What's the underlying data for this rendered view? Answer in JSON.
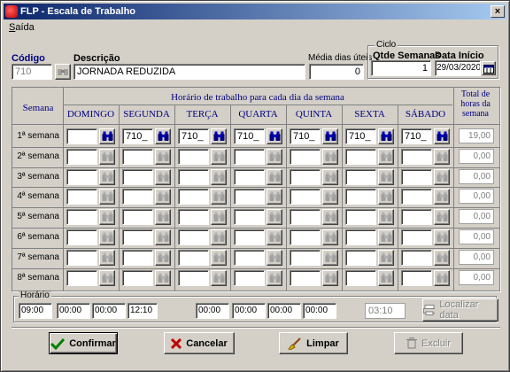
{
  "window": {
    "title": "FLP - Escala de Trabalho",
    "close_label": "×"
  },
  "menu": {
    "items": [
      {
        "label": "Saída"
      }
    ]
  },
  "form": {
    "codigo_label": "Código",
    "codigo_value": "710",
    "descricao_label": "Descrição",
    "descricao_value": "JORNADA REDUZIDA",
    "media_label": "Média dias úteis",
    "media_value": "0",
    "ciclo_title": "Ciclo",
    "qtde_semanas_label": "Qtde Semanas",
    "qtde_semanas_value": "1",
    "data_inicio_label": "Data Início",
    "data_inicio_value": "29/03/2020"
  },
  "grid": {
    "semana_header": "Semana",
    "horario_header": "Horário de trabalho para cada dia da semana",
    "total_header": "Total de horas da semana",
    "days": [
      "DOMINGO",
      "SEGUNDA",
      "TERÇA",
      "QUARTA",
      "QUINTA",
      "SEXTA",
      "SÁBADO"
    ],
    "weeks": [
      {
        "label": "1ª semana",
        "cells": [
          "",
          "710_",
          "710_",
          "710_",
          "710_",
          "710_",
          "710_"
        ],
        "total": "19,00"
      },
      {
        "label": "2ª semana",
        "cells": [
          "",
          "",
          "",
          "",
          "",
          "",
          ""
        ],
        "total": "0,00"
      },
      {
        "label": "3ª semana",
        "cells": [
          "",
          "",
          "",
          "",
          "",
          "",
          ""
        ],
        "total": "0,00"
      },
      {
        "label": "4ª semana",
        "cells": [
          "",
          "",
          "",
          "",
          "",
          "",
          ""
        ],
        "total": "0,00"
      },
      {
        "label": "5ª semana",
        "cells": [
          "",
          "",
          "",
          "",
          "",
          "",
          ""
        ],
        "total": "0,00"
      },
      {
        "label": "6ª semana",
        "cells": [
          "",
          "",
          "",
          "",
          "",
          "",
          ""
        ],
        "total": "0,00"
      },
      {
        "label": "7ª semana",
        "cells": [
          "",
          "",
          "",
          "",
          "",
          "",
          ""
        ],
        "total": "0,00"
      },
      {
        "label": "8ª semana",
        "cells": [
          "",
          "",
          "",
          "",
          "",
          "",
          ""
        ],
        "total": "0,00"
      }
    ]
  },
  "horario": {
    "title": "Horário",
    "times": [
      "09:00",
      "00:00",
      "00:00",
      "12:10",
      "00:00",
      "00:00",
      "00:00",
      "00:00"
    ],
    "total": "03:10"
  },
  "buttons": {
    "localizar": "Localizar data",
    "confirmar": "Confirmar",
    "cancelar": "Cancelar",
    "limpar": "Limpar",
    "excluir": "Excluir"
  }
}
